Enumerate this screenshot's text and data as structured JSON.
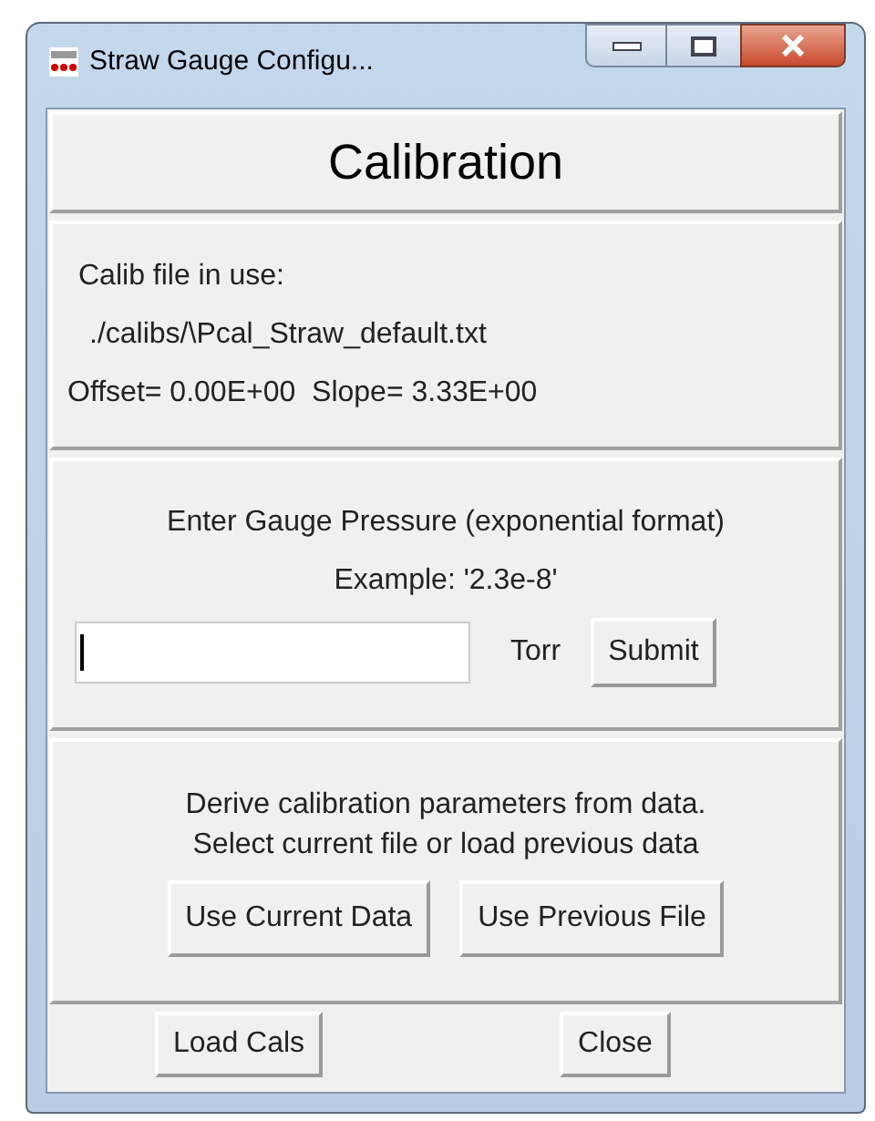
{
  "window": {
    "title": "Straw Gauge Configu..."
  },
  "heading": "Calibration",
  "calib_info": {
    "label": "Calib file in use:",
    "file": "./calibs/\\Pcal_Straw_default.txt",
    "params": "Offset= 0.00E+00  Slope= 3.33E+00"
  },
  "pressure": {
    "label": "Enter Gauge Pressure (exponential format)",
    "example": "Example: '2.3e-8'",
    "unit": "Torr",
    "submit": "Submit"
  },
  "derive": {
    "lines": [
      "Derive calibration parameters from data.",
      "Select current file or load previous data"
    ],
    "buttons": [
      "Use Current Data",
      "Use Previous File"
    ]
  },
  "footer_buttons": [
    "Load Cals",
    "Close"
  ]
}
